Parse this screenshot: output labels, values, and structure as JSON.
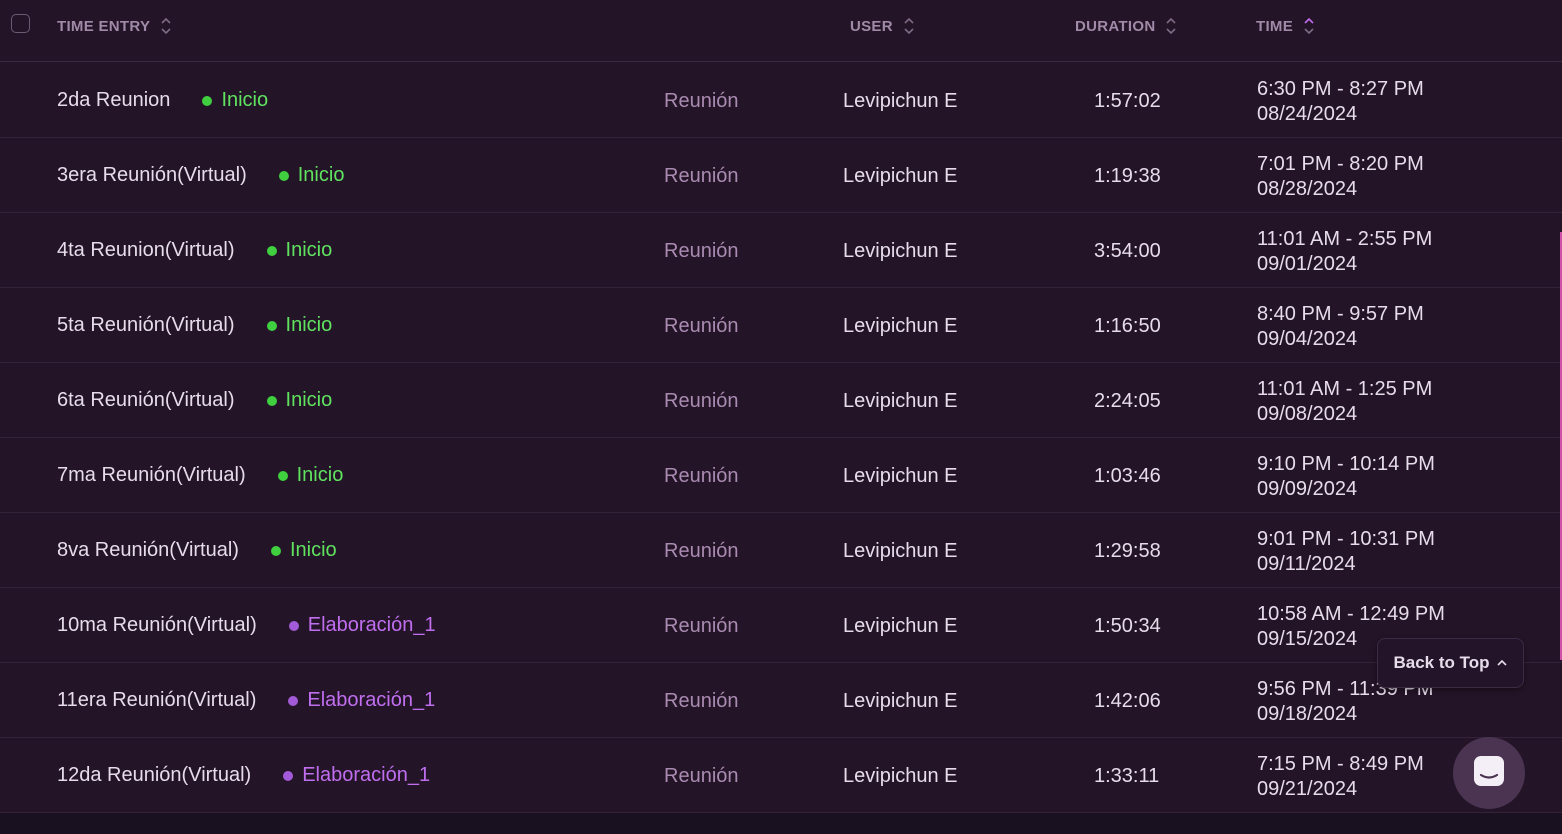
{
  "header": {
    "time_entry": "TIME ENTRY",
    "user": "USER",
    "duration": "DURATION",
    "time": "TIME"
  },
  "colors": {
    "inicio": "#3fcf3f",
    "inicio_text": "#5fe35f",
    "elaboracion": "#a35ad8",
    "elaboracion_text": "#c06ef0"
  },
  "rows": [
    {
      "name": "2da Reunion",
      "project": "Inicio",
      "ptype": "inicio",
      "tag": "Reunión",
      "user": "Levipichun E",
      "duration": "1:57:02",
      "range": "6:30 PM - 8:27 PM",
      "date": "08/24/2024"
    },
    {
      "name": "3era Reunión(Virtual)",
      "project": "Inicio",
      "ptype": "inicio",
      "tag": "Reunión",
      "user": "Levipichun E",
      "duration": "1:19:38",
      "range": "7:01 PM - 8:20 PM",
      "date": "08/28/2024"
    },
    {
      "name": "4ta Reunion(Virtual)",
      "project": "Inicio",
      "ptype": "inicio",
      "tag": "Reunión",
      "user": "Levipichun E",
      "duration": "3:54:00",
      "range": "11:01 AM - 2:55 PM",
      "date": "09/01/2024"
    },
    {
      "name": "5ta Reunión(Virtual)",
      "project": "Inicio",
      "ptype": "inicio",
      "tag": "Reunión",
      "user": "Levipichun E",
      "duration": "1:16:50",
      "range": "8:40 PM - 9:57 PM",
      "date": "09/04/2024"
    },
    {
      "name": "6ta Reunión(Virtual)",
      "project": "Inicio",
      "ptype": "inicio",
      "tag": "Reunión",
      "user": "Levipichun E",
      "duration": "2:24:05",
      "range": "11:01 AM - 1:25 PM",
      "date": "09/08/2024"
    },
    {
      "name": "7ma Reunión(Virtual)",
      "project": "Inicio",
      "ptype": "inicio",
      "tag": "Reunión",
      "user": "Levipichun E",
      "duration": "1:03:46",
      "range": "9:10 PM - 10:14 PM",
      "date": "09/09/2024"
    },
    {
      "name": "8va Reunión(Virtual)",
      "project": "Inicio",
      "ptype": "inicio",
      "tag": "Reunión",
      "user": "Levipichun E",
      "duration": "1:29:58",
      "range": "9:01 PM - 10:31 PM",
      "date": "09/11/2024"
    },
    {
      "name": "10ma Reunión(Virtual)",
      "project": "Elaboración_1",
      "ptype": "elaboracion",
      "tag": "Reunión",
      "user": "Levipichun E",
      "duration": "1:50:34",
      "range": "10:58 AM - 12:49 PM",
      "date": "09/15/2024"
    },
    {
      "name": "11era Reunión(Virtual)",
      "project": "Elaboración_1",
      "ptype": "elaboracion",
      "tag": "Reunión",
      "user": "Levipichun E",
      "duration": "1:42:06",
      "range": "9:56 PM - 11:39 PM",
      "date": "09/18/2024"
    },
    {
      "name": "12da Reunión(Virtual)",
      "project": "Elaboración_1",
      "ptype": "elaboracion",
      "tag": "Reunión",
      "user": "Levipichun E",
      "duration": "1:33:11",
      "range": "7:15 PM - 8:49 PM",
      "date": "09/21/2024"
    }
  ],
  "back_to_top": "Back to Top",
  "icons": {
    "sort": "sort-icon",
    "chevron": "chevron-up-icon",
    "chat": "chat-icon"
  }
}
